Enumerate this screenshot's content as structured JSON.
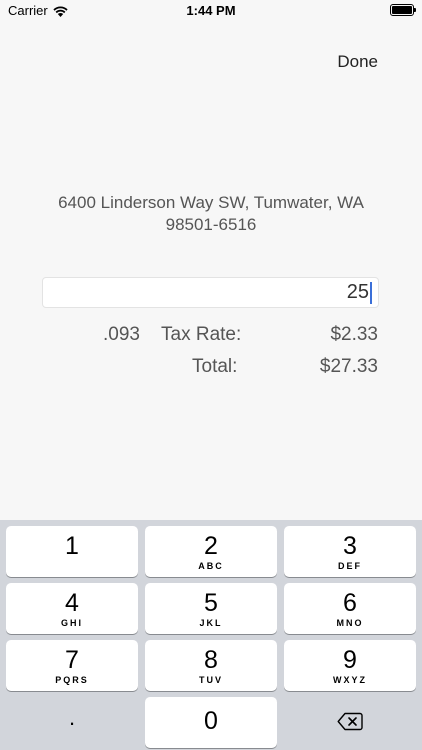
{
  "status_bar": {
    "carrier": "Carrier",
    "time": "1:44 PM"
  },
  "header": {
    "done_label": "Done"
  },
  "address": {
    "line1": "6400 Linderson Way SW, Tumwater, WA",
    "line2": "98501-6516"
  },
  "amount_input": {
    "value": "25"
  },
  "summary": {
    "rate": ".093",
    "tax_label": "Tax Rate:",
    "tax_value": "$2.33",
    "total_label": "Total:",
    "total_value": "$27.33"
  },
  "keyboard": {
    "keys": [
      {
        "num": "1",
        "letters": ""
      },
      {
        "num": "2",
        "letters": "ABC"
      },
      {
        "num": "3",
        "letters": "DEF"
      },
      {
        "num": "4",
        "letters": "GHI"
      },
      {
        "num": "5",
        "letters": "JKL"
      },
      {
        "num": "6",
        "letters": "MNO"
      },
      {
        "num": "7",
        "letters": "PQRS"
      },
      {
        "num": "8",
        "letters": "TUV"
      },
      {
        "num": "9",
        "letters": "WXYZ"
      }
    ],
    "dot": ".",
    "zero": "0",
    "delete_icon": "backspace-icon"
  },
  "colors": {
    "background": "#f7f7f7",
    "keyboard_bg": "#d2d5db",
    "cursor": "#3b6fd8"
  }
}
